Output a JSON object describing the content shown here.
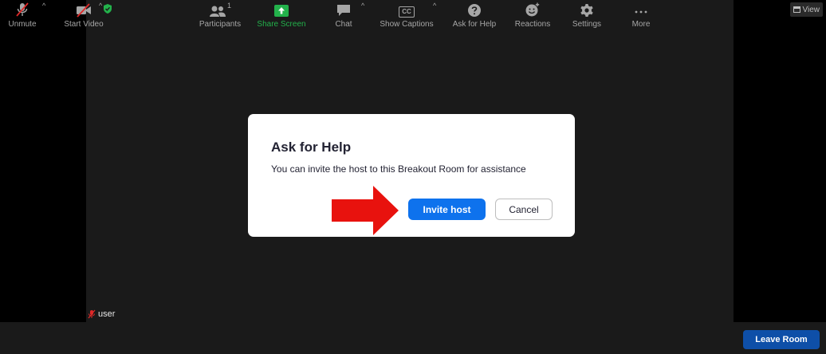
{
  "view": {
    "label": "View"
  },
  "user": {
    "name": "user"
  },
  "dialog": {
    "title": "Ask for Help",
    "message": "You can invite the host to this Breakout Room for assistance",
    "invite_label": "Invite host",
    "cancel_label": "Cancel"
  },
  "toolbar": {
    "unmute": "Unmute",
    "start_video": "Start Video",
    "participants": "Participants",
    "participants_count": "1",
    "share_screen": "Share Screen",
    "chat": "Chat",
    "show_captions": "Show Captions",
    "captions_icon_text": "CC",
    "ask_for_help": "Ask for Help",
    "reactions": "Reactions",
    "settings": "Settings",
    "more": "More",
    "leave_room": "Leave Room"
  },
  "colors": {
    "accent": "#0e72ed",
    "share_green": "#23b24b",
    "mute_red": "#e02828",
    "annotation_arrow": "#e8120e"
  }
}
